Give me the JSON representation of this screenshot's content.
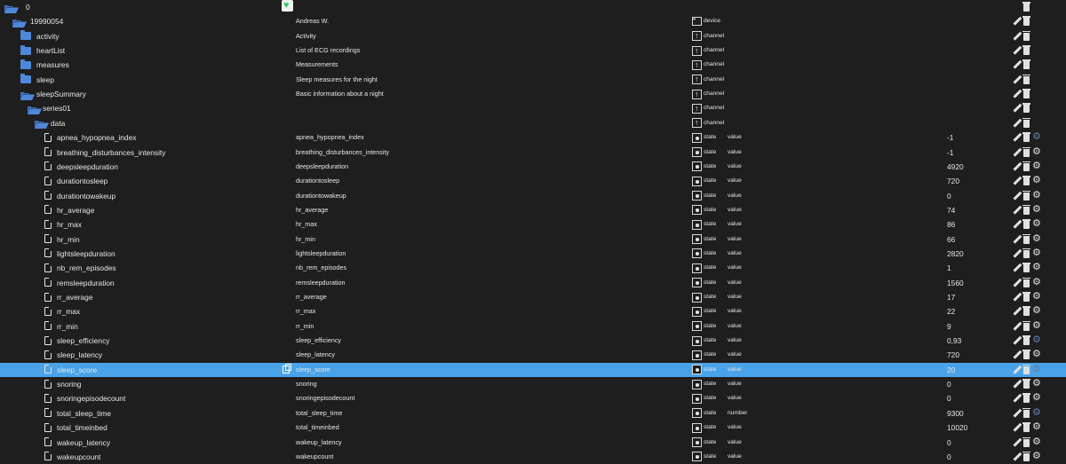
{
  "rows": [
    {
      "name": "0",
      "kind": "folder-open",
      "depth": 0,
      "desc": "",
      "type": "",
      "role": "",
      "value": "",
      "actions": [
        "trash"
      ],
      "badge": "heart"
    },
    {
      "name": "19990054",
      "kind": "folder-open",
      "depth": 1,
      "desc": "Andreas W.",
      "type": "device",
      "role": "",
      "value": "",
      "actions": [
        "pencil",
        "trash"
      ]
    },
    {
      "name": "activity",
      "kind": "folder",
      "depth": 2,
      "desc": "Activity",
      "type": "channel",
      "role": "",
      "value": "",
      "actions": [
        "pencil",
        "trash"
      ]
    },
    {
      "name": "heartList",
      "kind": "folder",
      "depth": 2,
      "desc": "List of ECG recordings",
      "type": "channel",
      "role": "",
      "value": "",
      "actions": [
        "pencil",
        "trash"
      ]
    },
    {
      "name": "measures",
      "kind": "folder",
      "depth": 2,
      "desc": "Measurements",
      "type": "channel",
      "role": "",
      "value": "",
      "actions": [
        "pencil",
        "trash"
      ]
    },
    {
      "name": "sleep",
      "kind": "folder",
      "depth": 2,
      "desc": "Sleep measures for the night",
      "type": "channel",
      "role": "",
      "value": "",
      "actions": [
        "pencil",
        "trash"
      ]
    },
    {
      "name": "sleepSummary",
      "kind": "folder-open",
      "depth": 2,
      "desc": "Basic information about a night",
      "type": "channel",
      "role": "",
      "value": "",
      "actions": [
        "pencil",
        "trash"
      ]
    },
    {
      "name": "series01",
      "kind": "folder-open",
      "depth": 3,
      "desc": "",
      "type": "channel",
      "role": "",
      "value": "",
      "actions": [
        "pencil",
        "trash"
      ]
    },
    {
      "name": "data",
      "kind": "folder-open",
      "depth": 4,
      "desc": "",
      "type": "channel",
      "role": "",
      "value": "",
      "actions": [
        "pencil",
        "trash"
      ]
    },
    {
      "name": "apnea_hypopnea_index",
      "kind": "file",
      "depth": 5,
      "desc": "apnea_hypopnea_index",
      "type": "state",
      "role": "value",
      "value": "-1",
      "actions": [
        "pencil",
        "trash",
        "gear-dim"
      ]
    },
    {
      "name": "breathing_disturbances_intensity",
      "kind": "file",
      "depth": 5,
      "desc": "breathing_disturbances_intensity",
      "type": "state",
      "role": "value",
      "value": "-1",
      "actions": [
        "pencil",
        "trash",
        "gear"
      ]
    },
    {
      "name": "deepsleepduration",
      "kind": "file",
      "depth": 5,
      "desc": "deepsleepduration",
      "type": "state",
      "role": "value",
      "value": "4920",
      "actions": [
        "pencil",
        "trash",
        "gear"
      ]
    },
    {
      "name": "durationtosleep",
      "kind": "file",
      "depth": 5,
      "desc": "durationtosleep",
      "type": "state",
      "role": "value",
      "value": "720",
      "actions": [
        "pencil",
        "trash",
        "gear"
      ]
    },
    {
      "name": "durationtowakeup",
      "kind": "file",
      "depth": 5,
      "desc": "durationtowakeup",
      "type": "state",
      "role": "value",
      "value": "0",
      "actions": [
        "pencil",
        "trash",
        "gear"
      ]
    },
    {
      "name": "hr_average",
      "kind": "file",
      "depth": 5,
      "desc": "hr_average",
      "type": "state",
      "role": "value",
      "value": "74",
      "actions": [
        "pencil",
        "trash",
        "gear"
      ]
    },
    {
      "name": "hr_max",
      "kind": "file",
      "depth": 5,
      "desc": "hr_max",
      "type": "state",
      "role": "value",
      "value": "86",
      "actions": [
        "pencil",
        "trash",
        "gear"
      ]
    },
    {
      "name": "hr_min",
      "kind": "file",
      "depth": 5,
      "desc": "hr_min",
      "type": "state",
      "role": "value",
      "value": "66",
      "actions": [
        "pencil",
        "trash",
        "gear"
      ]
    },
    {
      "name": "lightsleepduration",
      "kind": "file",
      "depth": 5,
      "desc": "lightsleepduration",
      "type": "state",
      "role": "value",
      "value": "2820",
      "actions": [
        "pencil",
        "trash",
        "gear"
      ]
    },
    {
      "name": "nb_rem_episodes",
      "kind": "file",
      "depth": 5,
      "desc": "nb_rem_episodes",
      "type": "state",
      "role": "value",
      "value": "1",
      "actions": [
        "pencil",
        "trash",
        "gear"
      ]
    },
    {
      "name": "remsleepduration",
      "kind": "file",
      "depth": 5,
      "desc": "remsleepduration",
      "type": "state",
      "role": "value",
      "value": "1560",
      "actions": [
        "pencil",
        "trash",
        "gear"
      ]
    },
    {
      "name": "rr_average",
      "kind": "file",
      "depth": 5,
      "desc": "rr_average",
      "type": "state",
      "role": "value",
      "value": "17",
      "actions": [
        "pencil",
        "trash",
        "gear"
      ]
    },
    {
      "name": "rr_max",
      "kind": "file",
      "depth": 5,
      "desc": "rr_max",
      "type": "state",
      "role": "value",
      "value": "22",
      "actions": [
        "pencil",
        "trash",
        "gear"
      ]
    },
    {
      "name": "rr_min",
      "kind": "file",
      "depth": 5,
      "desc": "rr_min",
      "type": "state",
      "role": "value",
      "value": "9",
      "actions": [
        "pencil",
        "trash",
        "gear"
      ]
    },
    {
      "name": "sleep_efficiency",
      "kind": "file",
      "depth": 5,
      "desc": "sleep_efficiency",
      "type": "state",
      "role": "value",
      "value": "0,93",
      "actions": [
        "pencil",
        "trash",
        "gear-dim"
      ]
    },
    {
      "name": "sleep_latency",
      "kind": "file",
      "depth": 5,
      "desc": "sleep_latency",
      "type": "state",
      "role": "value",
      "value": "720",
      "actions": [
        "pencil",
        "trash",
        "gear"
      ]
    },
    {
      "name": "sleep_score",
      "kind": "file",
      "depth": 5,
      "desc": "sleep_score",
      "type": "state",
      "role": "value",
      "value": "20",
      "actions": [
        "pencil",
        "trash",
        "gear-dim"
      ],
      "selected": true
    },
    {
      "name": "snoring",
      "kind": "file",
      "depth": 5,
      "desc": "snoring",
      "type": "state",
      "role": "value",
      "value": "0",
      "actions": [
        "pencil",
        "trash",
        "gear"
      ]
    },
    {
      "name": "snoringepisodecount",
      "kind": "file",
      "depth": 5,
      "desc": "snoringepisodecount",
      "type": "state",
      "role": "value",
      "value": "0",
      "actions": [
        "pencil",
        "trash",
        "gear"
      ]
    },
    {
      "name": "total_sleep_time",
      "kind": "file",
      "depth": 5,
      "desc": "total_sleep_time",
      "type": "state",
      "role": "number",
      "value": "9300",
      "actions": [
        "pencil",
        "trash",
        "gear-dim"
      ]
    },
    {
      "name": "total_timeinbed",
      "kind": "file",
      "depth": 5,
      "desc": "total_timeinbed",
      "type": "state",
      "role": "value",
      "value": "10020",
      "actions": [
        "pencil",
        "trash",
        "gear"
      ]
    },
    {
      "name": "wakeup_latency",
      "kind": "file",
      "depth": 5,
      "desc": "wakeup_latency",
      "type": "state",
      "role": "value",
      "value": "0",
      "actions": [
        "pencil",
        "trash",
        "gear"
      ]
    },
    {
      "name": "wakeupcount",
      "kind": "file",
      "depth": 5,
      "desc": "wakeupcount",
      "type": "state",
      "role": "value",
      "value": "0",
      "actions": [
        "pencil",
        "trash",
        "gear"
      ]
    }
  ],
  "colors": {
    "background": "#1e1e1e",
    "selected_row": "#4aa3e8",
    "folder": "#4f87d9",
    "heart": "#3ec66b"
  }
}
